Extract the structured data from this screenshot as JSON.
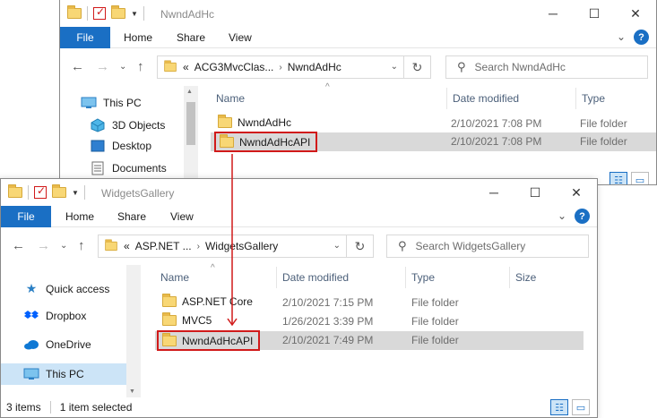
{
  "colors": {
    "accent": "#1a6fc4",
    "highlight": "#d11a1a",
    "folder": "#f8d775",
    "selected_row": "#d9d9d9"
  },
  "window_back": {
    "title": "NwndAdHc",
    "ribbon": {
      "file": "File",
      "tabs": [
        "Home",
        "Share",
        "View"
      ]
    },
    "address": {
      "prefix": "«",
      "crumb_1": "ACG3MvcClas...",
      "sep": "›",
      "crumb_2": "NwndAdHc"
    },
    "search_placeholder": "Search NwndAdHc",
    "nav_pane": [
      {
        "label": "This PC",
        "icon": "monitor-icon"
      },
      {
        "label": "3D Objects",
        "icon": "cube-icon"
      },
      {
        "label": "Desktop",
        "icon": "desktop-icon"
      },
      {
        "label": "Documents",
        "icon": "document-icon"
      }
    ],
    "columns": {
      "name": "Name",
      "date": "Date modified",
      "type": "Type"
    },
    "rows": [
      {
        "name": "NwndAdHc",
        "date": "2/10/2021 7:08 PM",
        "type": "File folder"
      },
      {
        "name": "NwndAdHcAPI",
        "date": "2/10/2021 7:08 PM",
        "type": "File folder"
      }
    ]
  },
  "window_front": {
    "title": "WidgetsGallery",
    "ribbon": {
      "file": "File",
      "tabs": [
        "Home",
        "Share",
        "View"
      ]
    },
    "address": {
      "prefix": "«",
      "crumb_1": "ASP.NET ...",
      "sep": "›",
      "crumb_2": "WidgetsGallery"
    },
    "search_placeholder": "Search WidgetsGallery",
    "nav_pane": [
      {
        "label": "Quick access",
        "icon": "star-icon"
      },
      {
        "label": "Dropbox",
        "icon": "dropbox-icon"
      },
      {
        "label": "OneDrive",
        "icon": "cloud-icon"
      },
      {
        "label": "This PC",
        "icon": "monitor-icon"
      }
    ],
    "columns": {
      "name": "Name",
      "date": "Date modified",
      "type": "Type",
      "size": "Size"
    },
    "rows": [
      {
        "name": "ASP.NET Core",
        "date": "2/10/2021 7:15 PM",
        "type": "File folder"
      },
      {
        "name": "MVC5",
        "date": "1/26/2021 3:39 PM",
        "type": "File folder"
      },
      {
        "name": "NwndAdHcAPI",
        "date": "2/10/2021 7:49 PM",
        "type": "File folder"
      }
    ],
    "status": {
      "count": "3 items",
      "selection": "1 item selected"
    }
  }
}
